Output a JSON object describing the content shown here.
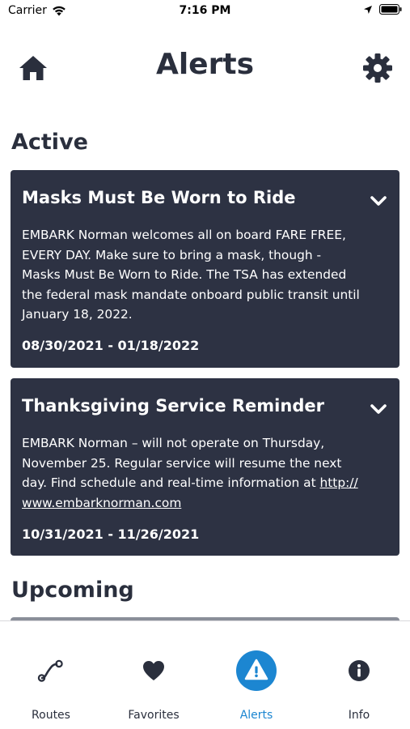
{
  "status_bar": {
    "carrier": "Carrier",
    "time": "7:16 PM"
  },
  "header": {
    "title": "Alerts"
  },
  "sections": {
    "active_title": "Active",
    "upcoming_title": "Upcoming"
  },
  "alerts": [
    {
      "title": "Masks Must Be Worn to Ride",
      "lines": [
        "EMBARK Norman welcomes all on board FARE FREE,",
        "EVERY DAY. Make sure to bring a mask, though -",
        "Masks Must Be Worn to Ride. The TSA has extended",
        "the federal mask mandate onboard public transit until",
        "January 18, 2022."
      ],
      "dates": "08/30/2021 - 01/18/2022"
    },
    {
      "title": "Thanksgiving Service Reminder",
      "lines": [
        "EMBARK Norman – will not operate on Thursday,",
        "November 25.  Regular service will resume the next",
        "day. Find schedule and real-time information at "
      ],
      "link_part1": "http://",
      "link_part2": "www.embarknorman.com",
      "dates": "10/31/2021 - 11/26/2021"
    }
  ],
  "tabs": [
    {
      "label": "Routes",
      "icon": "route-icon"
    },
    {
      "label": "Favorites",
      "icon": "heart-icon"
    },
    {
      "label": "Alerts",
      "icon": "alert-icon",
      "active": true
    },
    {
      "label": "Info",
      "icon": "info-icon"
    }
  ],
  "colors": {
    "card_bg": "#2d3243",
    "text_dark": "#2a2f3d",
    "accent": "#1c86d1"
  }
}
